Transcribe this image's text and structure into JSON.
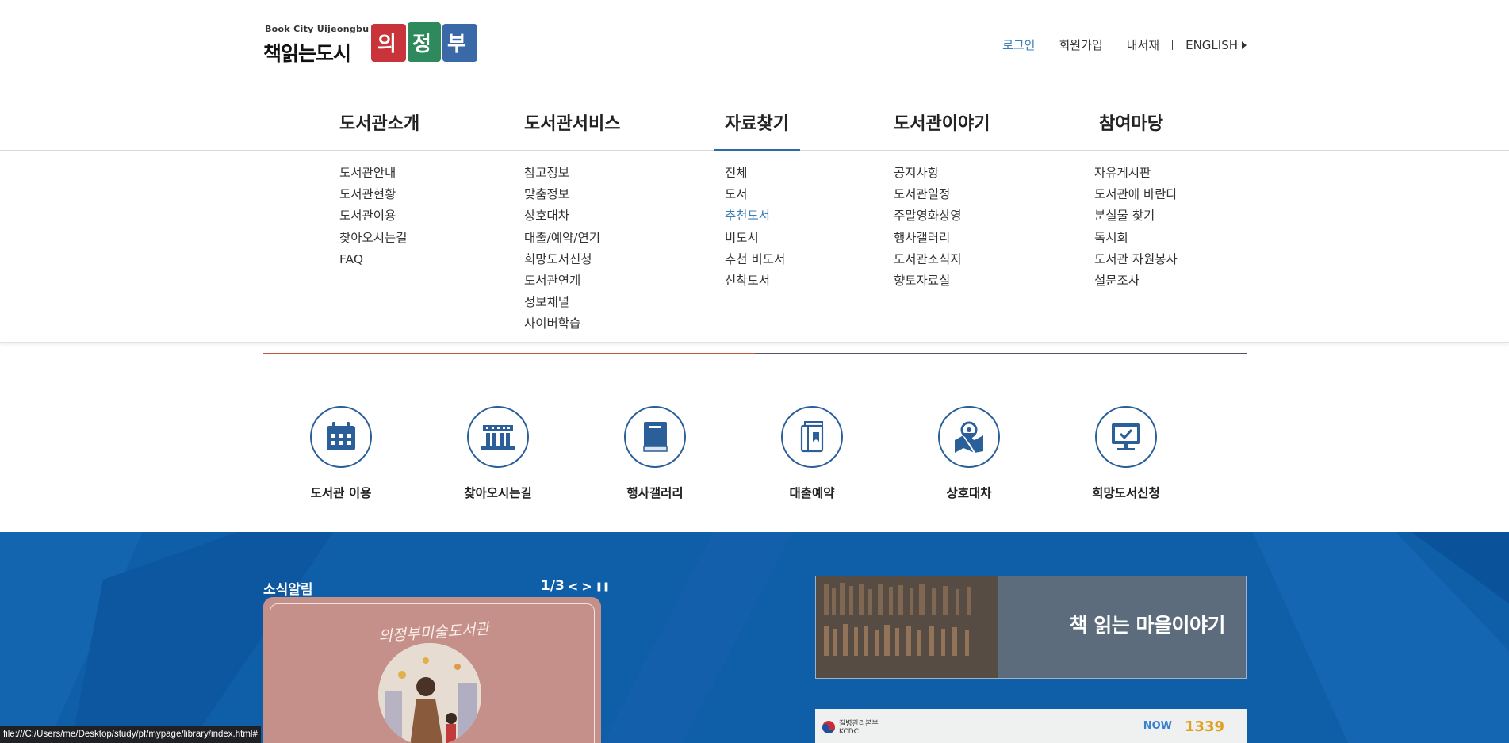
{
  "header": {
    "logo_sub": "Book City Uijeongbu",
    "logo_main": "책읽는도시",
    "util": {
      "login": "로그인",
      "join": "회원가입",
      "mylib": "내서재",
      "english": "ENGLISH"
    }
  },
  "gnb": {
    "menus": [
      "도서관소개",
      "도서관서비스",
      "자료찾기",
      "도서관이야기",
      "참여마당"
    ],
    "active": "자료찾기"
  },
  "submenu": {
    "col0": [
      "도서관안내",
      "도서관현황",
      "도서관이용",
      "찾아오시는길",
      "FAQ"
    ],
    "col1": [
      "참고정보",
      "맞춤정보",
      "상호대차",
      "대출/예약/연기",
      "희망도서신청",
      "도서관연계",
      "정보채널",
      "사이버학습"
    ],
    "col2": [
      "전체",
      "도서",
      "추천도서",
      "비도서",
      "추천 비도서",
      "신착도서"
    ],
    "col3": [
      "공지사항",
      "도서관일정",
      "주말영화상영",
      "행사갤러리",
      "도서관소식지",
      "향토자료실"
    ],
    "col4": [
      "자유게시판",
      "도서관에 바란다",
      "분실물 찾기",
      "독서회",
      "도서관 자원봉사",
      "설문조사"
    ],
    "highlighted": "추천도서"
  },
  "quick_menu": [
    {
      "label": "도서관 이용",
      "icon": "calendar-icon"
    },
    {
      "label": "찾아오시는길",
      "icon": "building-icon"
    },
    {
      "label": "행사갤러리",
      "icon": "book-icon"
    },
    {
      "label": "대출예약",
      "icon": "book-return-icon"
    },
    {
      "label": "상호대차",
      "icon": "map-pin-icon"
    },
    {
      "label": "희망도서신청",
      "icon": "monitor-check-icon"
    }
  ],
  "news": {
    "title": "소식알림",
    "counter": "1/3",
    "prev": "<",
    "next": ">",
    "pause": "❚❚",
    "card_script": "의정부미술도서관"
  },
  "banners": {
    "story": "책 읽는 마을이야기",
    "kdca": "질병관리본부\nKCDC",
    "now": "NOW",
    "hotline": "1339"
  },
  "status_url": "file:///C:/Users/me/Desktop/study/pf/mypage/library/index.html#",
  "colors": {
    "accent_blue": "#3b7fb8",
    "band_blue": "#0f5ea8",
    "icon_blue": "#2a5f9a",
    "line_red": "#c2533c"
  }
}
